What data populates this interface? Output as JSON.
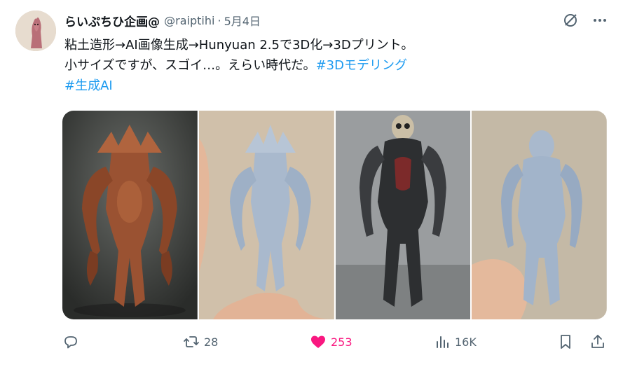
{
  "author": {
    "display_name": "らいぷちひ企画@",
    "handle": "@raiptihi",
    "separator": "·",
    "date": "5月4日"
  },
  "tweet": {
    "line1": "粘土造形→AI画像生成→Hunyuan 2.5で3D化→3Dプリント。",
    "line2_text": "小サイズですが、スゴイ…。えらい時代だ。",
    "hashtag1": "#3Dモデリング",
    "hashtag2": "#生成AI"
  },
  "media": [
    {
      "name": "clay-crab-monster-photo",
      "icon": "image"
    },
    {
      "name": "printed-crab-monster-photo",
      "icon": "image"
    },
    {
      "name": "skull-robot-render-photo",
      "icon": "image"
    },
    {
      "name": "printed-skull-robot-photo",
      "icon": "image"
    }
  ],
  "actions": {
    "reply": {
      "icon": "reply-icon",
      "count": ""
    },
    "retweet": {
      "icon": "retweet-icon",
      "count": "28"
    },
    "like": {
      "icon": "heart-icon",
      "count": "253",
      "color": "#f91880",
      "liked": true
    },
    "views": {
      "icon": "views-icon",
      "count": "16K"
    },
    "bookmark": {
      "icon": "bookmark-icon"
    },
    "share": {
      "icon": "share-icon"
    }
  },
  "colors": {
    "text": "#0f1419",
    "muted": "#536471",
    "link": "#1d9bf0",
    "like": "#f91880"
  }
}
